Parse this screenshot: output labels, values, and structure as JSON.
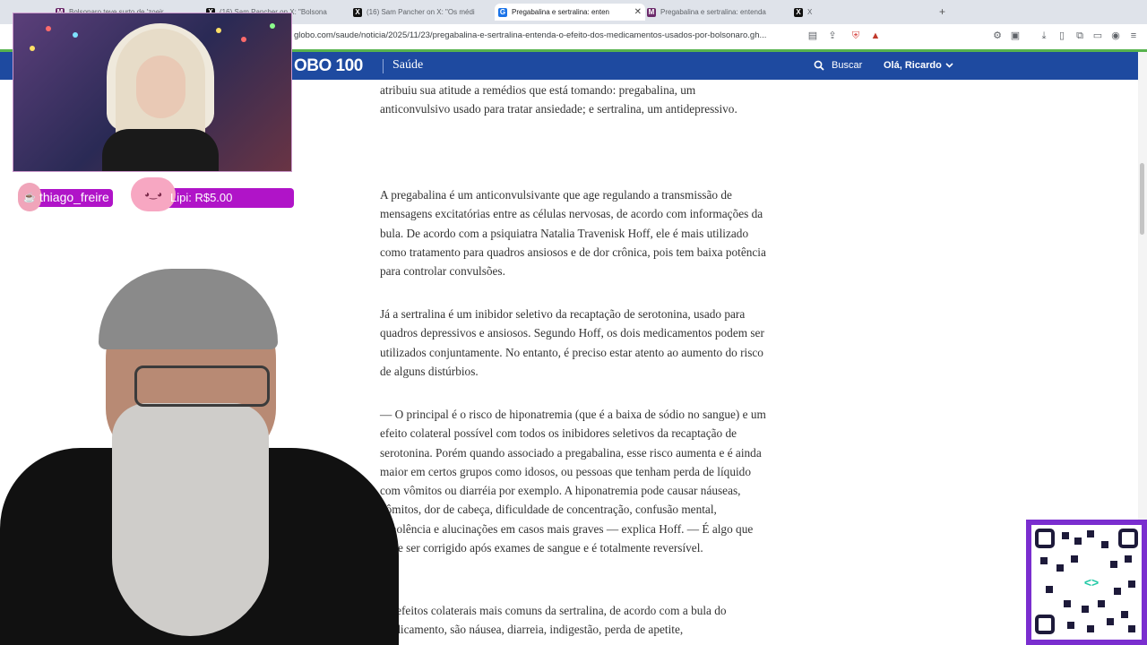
{
  "browser": {
    "tabs": [
      {
        "label": "Bolsonaro teve surto de 'zoeir...",
        "icon": "m-icon",
        "active": false
      },
      {
        "label": "(16) Sam Pancher on X: \"Bolsona",
        "icon": "x-icon",
        "active": false
      },
      {
        "label": "(16) Sam Pancher on X: \"Os médi",
        "icon": "x-icon",
        "active": false
      },
      {
        "label": "Pregabalina e sertralina: enten",
        "icon": "g-icon",
        "active": true
      },
      {
        "label": "Pregabalina e sertralina: entenda",
        "icon": "m-icon",
        "active": false
      },
      {
        "label": "X",
        "icon": "x-icon",
        "active": false
      }
    ],
    "new_tab_symbol": "+",
    "url": "globo.com/saude/noticia/2025/11/23/pregabalina-e-sertralina-entenda-o-efeito-dos-medicamentos-usados-por-bolsonaro.gh..."
  },
  "site": {
    "logo": "OBO 100",
    "section": "Saúde",
    "search_label": "Buscar",
    "user_label": "Olá, Ricardo",
    "header_color": "#1e4aa0"
  },
  "article": {
    "paragraphs": [
      "atribuiu sua atitude a remédios que está tomando: pregabalina, um anticonvulsivo usado para tratar ansiedade; e sertralina, um antidepressivo.",
      "A pregabalina é um anticonvulsivante que age regulando a transmissão de mensagens excitatórias entre as células nervosas, de acordo com informações da bula. De acordo com a psiquiatra Natalia Travenisk Hoff, ele é mais utilizado como tratamento para quadros ansiosos e de dor crônica, pois tem baixa potência para controlar convulsões.",
      "Já a sertralina é um inibidor seletivo da recaptação de serotonina, usado para quadros depressivos e ansiosos. Segundo Hoff, os dois medicamentos podem ser utilizados conjuntamente. No entanto, é preciso estar atento ao aumento do risco de alguns distúrbios.",
      "— O principal é o risco de hiponatremia (que é a baixa de sódio no sangue) e um efeito colateral possível com todos os inibidores seletivos da recaptação de serotonina. Porém quando associado a pregabalina, esse risco aumenta e é ainda maior em certos grupos como idosos, ou pessoas que tenham perda de líquido com vômitos ou diarréia por exemplo. A hiponatremia pode causar náuseas, vômitos, dor de cabeça, dificuldade de concentração, confusão mental, sonolência e alucinações em casos mais graves — explica Hoff. — É algo que pode ser corrigido após exames de sangue e é totalmente reversível.",
      "Os efeitos colaterais mais comuns da sertralina, de acordo com a bula do medicamento, são náusea, diarreia, indigestão, perda de apetite,"
    ]
  },
  "overlay": {
    "alert1": "thiago_freire",
    "alert2": "Lipi: R$5.00",
    "accent": "#b014c8"
  }
}
